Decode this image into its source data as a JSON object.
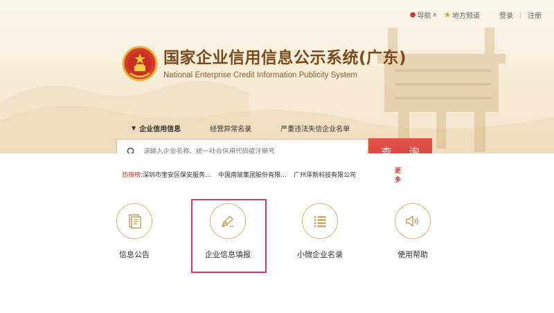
{
  "topbar": {
    "nav_label": "导航",
    "local_label": "地方频道",
    "login_label": "登录",
    "register_label": "注册"
  },
  "header": {
    "title_cn": "国家企业信用信息公示系统(广东)",
    "title_en": "National Enterprise Credit Information Publicity System"
  },
  "tabs": [
    {
      "label": "企业信用信息",
      "active": true
    },
    {
      "label": "经营异常名录",
      "active": false
    },
    {
      "label": "严重违法失信企业名单",
      "active": false
    }
  ],
  "search": {
    "placeholder": "请输入企业名称、统一社会信用代码或注册号",
    "button_label": "查 询"
  },
  "hot_search": {
    "label": "热搜榜:",
    "items": [
      "深圳市宝安区保安服务…",
      "中国南玻集团股份有限…",
      "广州泽新科技有限公司"
    ],
    "more_label": "更多"
  },
  "features": [
    {
      "label": "信息公告",
      "icon": "document-icon"
    },
    {
      "label": "企业信息填报",
      "icon": "pen-icon"
    },
    {
      "label": "小微企业名录",
      "icon": "list-icon"
    },
    {
      "label": "使用帮助",
      "icon": "speaker-icon"
    }
  ],
  "colors": {
    "brand_brown": "#7a4a1c",
    "search_red": "#d13b31",
    "gold_border": "#d7b575",
    "highlight_pink": "#d9336a"
  }
}
